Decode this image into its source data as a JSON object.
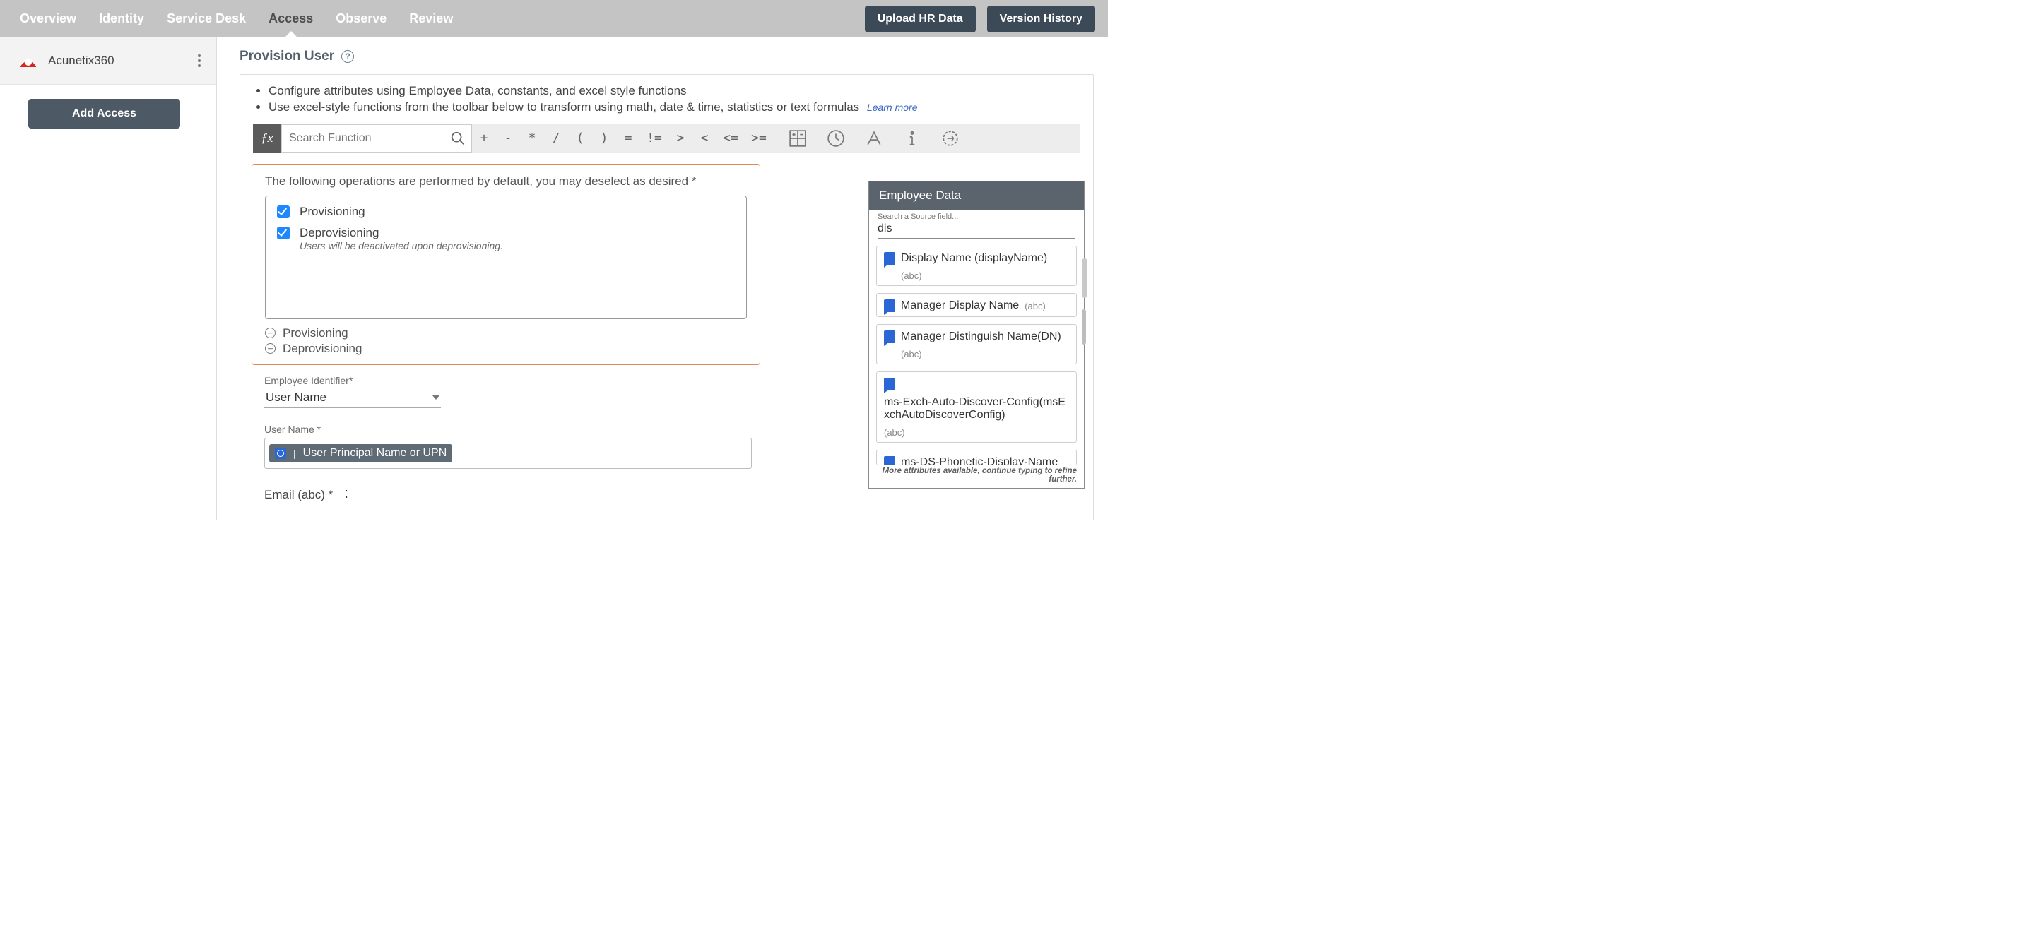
{
  "nav": {
    "tabs": [
      "Overview",
      "Identity",
      "Service Desk",
      "Access",
      "Observe",
      "Review"
    ],
    "active_index": 3,
    "upload_btn": "Upload HR Data",
    "version_btn": "Version History"
  },
  "sidebar": {
    "app_name": "Acunetix360",
    "add_access": "Add Access"
  },
  "page": {
    "title": "Provision User"
  },
  "intro": {
    "line1": "Configure attributes using Employee Data, constants, and excel style functions",
    "line2": "Use excel-style functions from the toolbar below to transform using math, date & time, statistics or text formulas",
    "learn_more": "Learn more"
  },
  "toolbar": {
    "search_placeholder": "Search Function",
    "ops": [
      "+",
      "-",
      "*",
      "/",
      "(",
      ")",
      "=",
      "!=",
      ">",
      "<",
      "<=",
      ">="
    ]
  },
  "operations": {
    "caption": "The following operations are performed by default, you may deselect as desired *",
    "provisioning_label": "Provisioning",
    "deprovisioning_label": "Deprovisioning",
    "deprovisioning_note": "Users will be deactivated upon deprovisioning.",
    "row_prov": "Provisioning",
    "row_deprov": "Deprovisioning"
  },
  "employee_identifier": {
    "label": "Employee Identifier*",
    "value": "User Name"
  },
  "user_name": {
    "label": "User Name *",
    "chip_text": "User Principal Name or UPN"
  },
  "email": {
    "label": "Email (abc) *"
  },
  "emp_panel": {
    "title": "Employee Data",
    "search_label": "Search a Source field...",
    "search_value": "dis",
    "items": [
      {
        "name": "Display Name (displayName)",
        "type": "(abc)",
        "wrap": true
      },
      {
        "name": "Manager Display Name",
        "type": "(abc)",
        "wrap": false
      },
      {
        "name": "Manager Distinguish Name(DN)",
        "type": "(abc)",
        "wrap": true
      },
      {
        "name": "ms-Exch-Auto-Discover-Config(msExchAutoDiscoverConfig)",
        "type": "(abc)",
        "wrap": false
      },
      {
        "name": "ms-DS-Phonetic-Display-Name",
        "type": "",
        "wrap": false
      }
    ],
    "footer": "More attributes available, continue typing to refine further."
  }
}
